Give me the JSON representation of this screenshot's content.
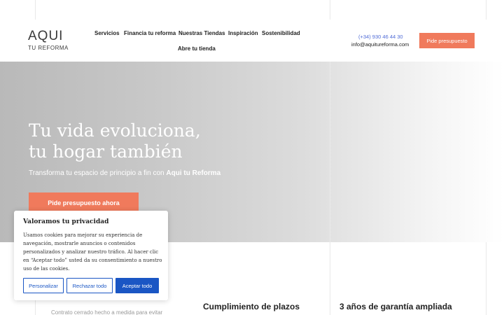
{
  "logo": {
    "main": "AQUI",
    "sub": "TU REFORMA"
  },
  "nav": {
    "items": [
      {
        "label": "Servicios"
      },
      {
        "label": "Financia tu reforma"
      },
      {
        "label": "Nuestras Tiendas"
      },
      {
        "label": "Inspiración"
      },
      {
        "label": "Sostenibilidad"
      },
      {
        "label": "Abre tu tienda"
      }
    ]
  },
  "contact": {
    "phone": "(+34) 930 46 44 30",
    "email": "info@aquitureforma.com"
  },
  "header": {
    "cta_label": "Pide presupuesto"
  },
  "hero": {
    "title_line1": "Tu vida evoluciona,",
    "title_line2": "tu hogar también",
    "subtitle_prefix": "Transforma tu espacio de principio a fin con ",
    "subtitle_brand": "Aqui tu Reforma",
    "cta_label": "Pide presupuesto ahora"
  },
  "features": [
    {
      "title": "Cumplimiento de plazos"
    },
    {
      "title": "3 años de garantía ampliada"
    }
  ],
  "features_text": "Contrato cerrado hecho a medida para evitar",
  "cookie": {
    "title": "Valoramos tu privacidad",
    "text": "Usamos cookies para mejorar su experiencia de navegación, mostrarle anuncios o contenidos personalizados y analizar nuestro tráfico. Al hacer clic en “Aceptar todo” usted da su consentimiento a nuestro uso de las cookies.",
    "customize_label": "Personalizar",
    "reject_label": "Rechazar todo",
    "accept_label": "Aceptar todo"
  },
  "colors": {
    "accent": "#f07a5c",
    "link_blue": "#4f6bd6",
    "cookie_blue": "#1a56c4"
  }
}
